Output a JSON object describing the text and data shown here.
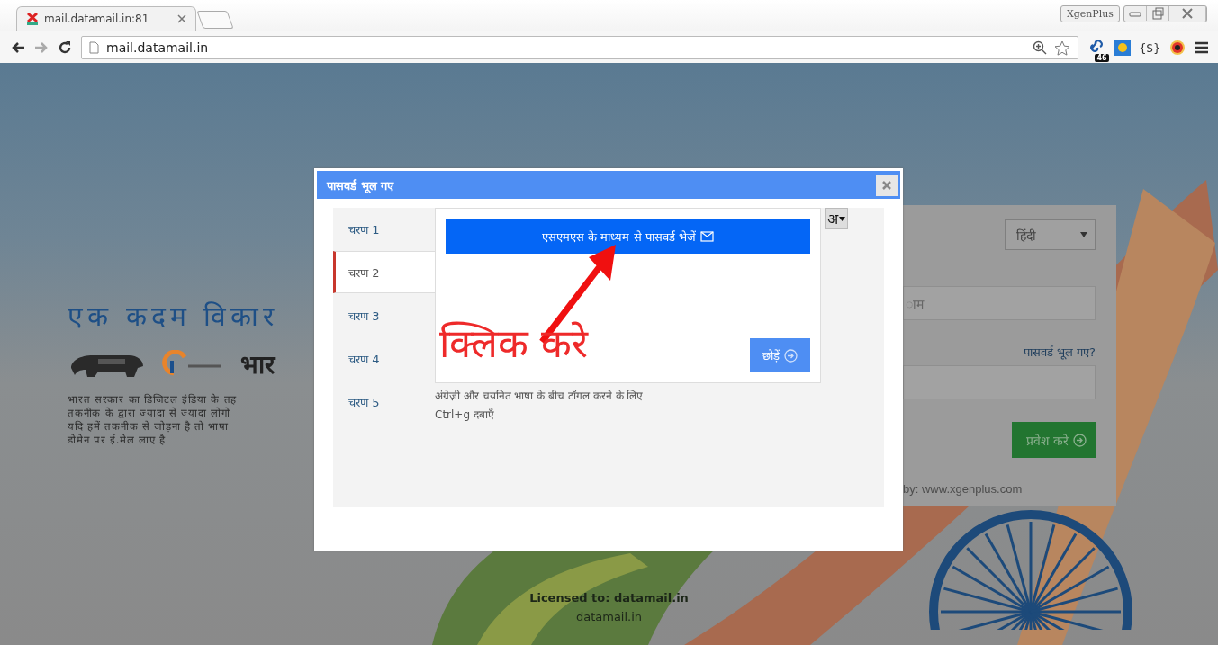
{
  "browser": {
    "tab_title": "mail.datamail.in:81",
    "profile_name": "XgenPlus",
    "address": "mail.datamail.in",
    "extension_badge": "46",
    "extension_label": "{S}"
  },
  "page": {
    "heading": "एक कदम विकार",
    "logo_text": "भार",
    "description": [
      "भारत सरकार का डिजिटल इंडिया के तह",
      "तकनीक के द्वारा ज्यादा से ज्यादा लोगो",
      "यदि हमें तकनीक से जोड़ना है तो भाषा",
      "डोमेन पर ई.मेल लाए है"
    ],
    "language_select": "हिंदी",
    "username_placeholder": "ाम",
    "forgot_link": "पासवर्ड भूल गए?",
    "login_button": "प्रवेश करे",
    "powered_by": "by: www.xgenplus.com",
    "license": "Licensed to: datamail.in",
    "footer_domain": "datamail.in"
  },
  "dialog": {
    "title": "पासवर्ड भूल गए",
    "steps": [
      {
        "label": "चरण 1",
        "selected": false
      },
      {
        "label": "चरण 2",
        "selected": true
      },
      {
        "label": "चरण 3",
        "selected": false
      },
      {
        "label": "चरण 4",
        "selected": false
      },
      {
        "label": "चरण 5",
        "selected": false
      }
    ],
    "sms_button": "एसएमएस के माध्यम से पासवर्ड भेजें",
    "skip_button": "छोड़ें",
    "keyboard_toggle": "अ",
    "hint": [
      "अंग्रेज़ी और चयनित भाषा के बीच टॉगल करने के लिए",
      "Ctrl+g दबाएँ"
    ]
  },
  "annotation": {
    "text": "क्लिक करे"
  }
}
